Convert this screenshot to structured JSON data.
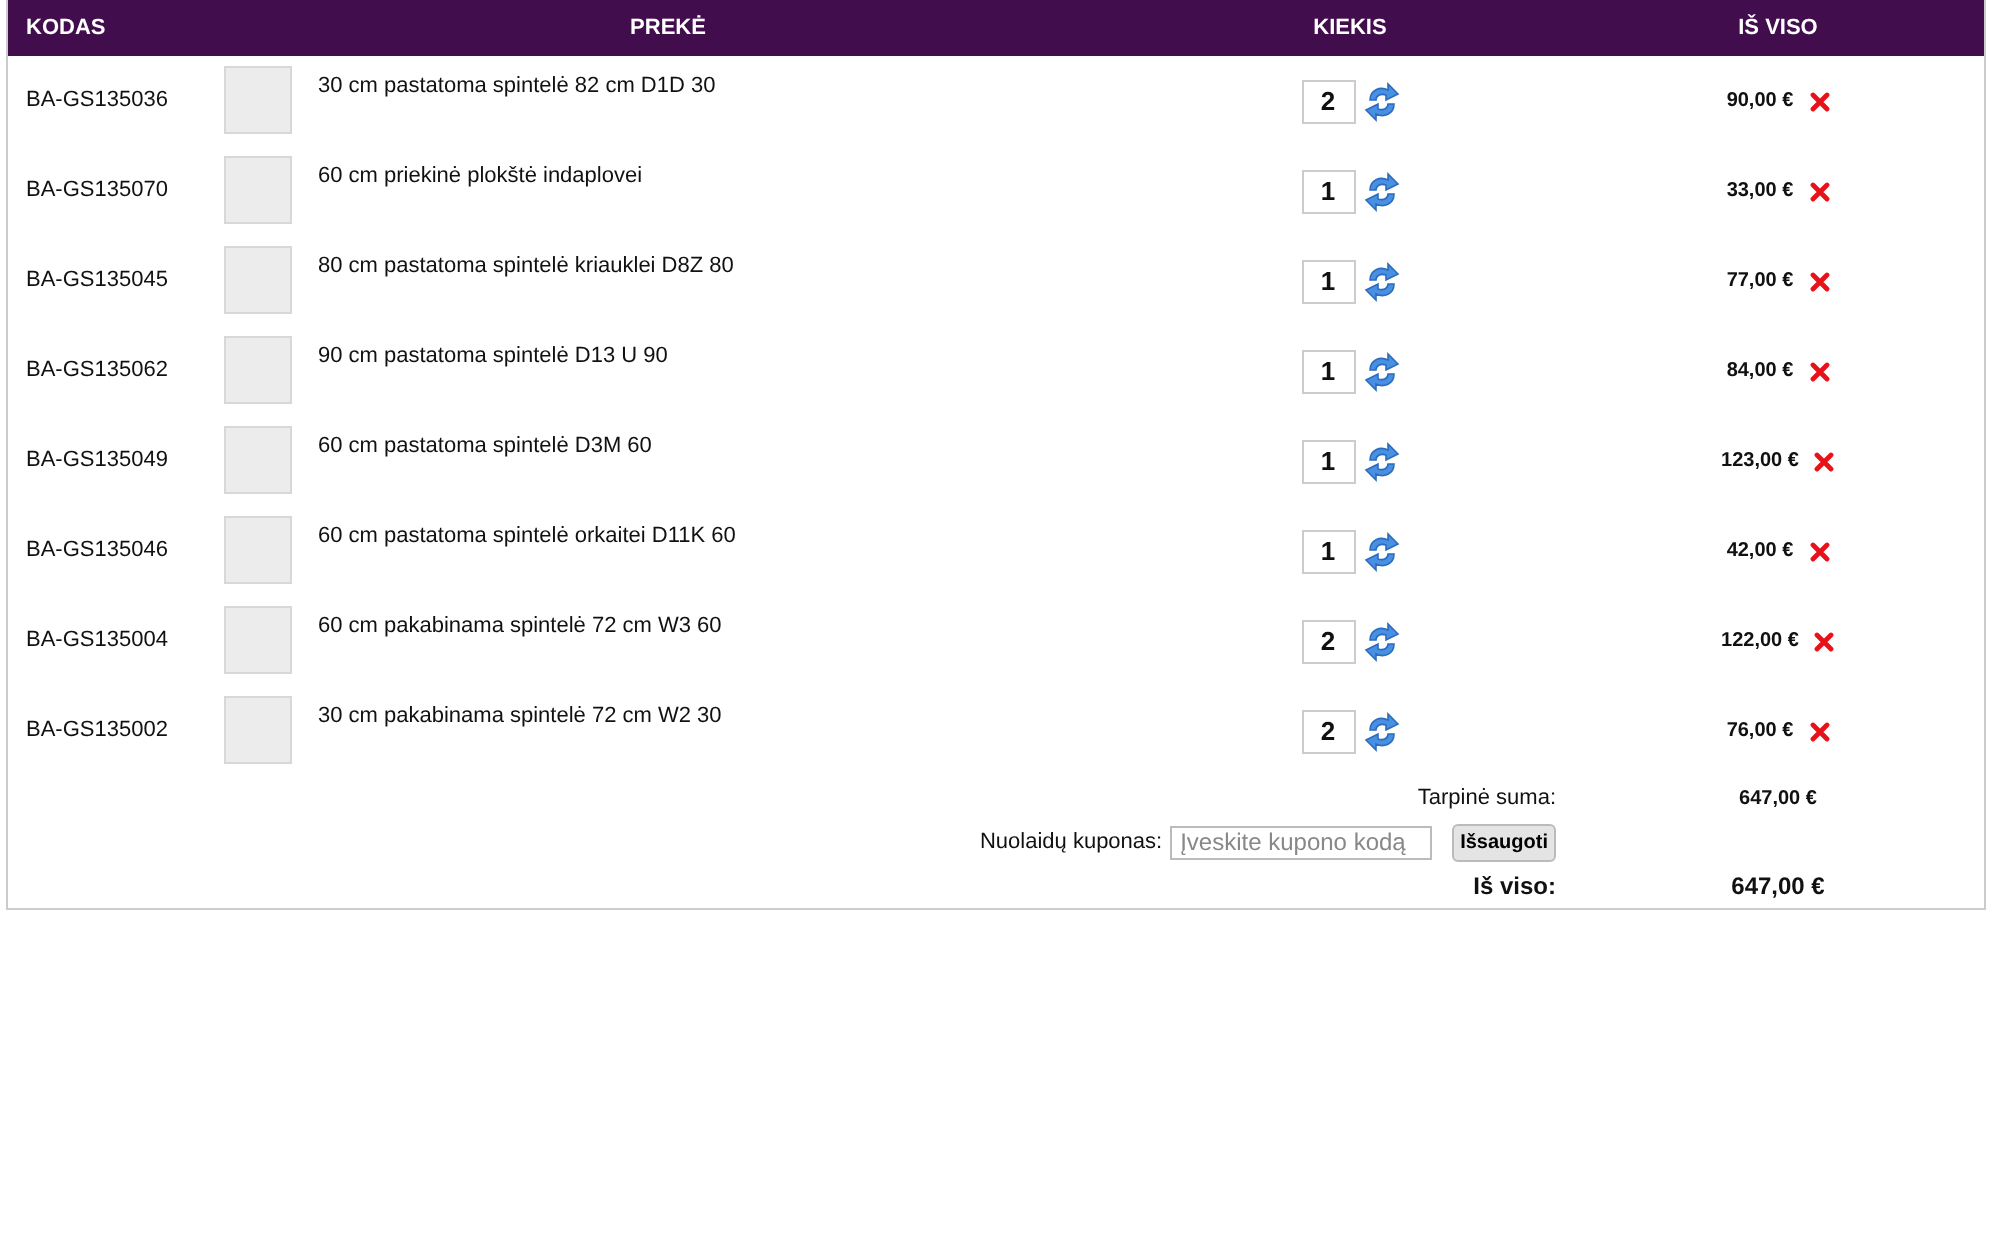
{
  "table": {
    "columns": [
      "KODAS",
      "PREKĖ",
      "KIEKIS",
      "IŠ VISO"
    ],
    "rows": [
      {
        "code": "BA-GS135036",
        "name": "30 cm pastatoma spintelė 82 cm D1D 30",
        "quantity": "2",
        "total": "90,00 €"
      },
      {
        "code": "BA-GS135070",
        "name": "60 cm priekinė plokštė indaplovei",
        "quantity": "1",
        "total": "33,00 €"
      },
      {
        "code": "BA-GS135045",
        "name": "80 cm pastatoma spintelė kriauklei D8Z 80",
        "quantity": "1",
        "total": "77,00 €"
      },
      {
        "code": "BA-GS135062",
        "name": "90 cm pastatoma spintelė D13 U 90",
        "quantity": "1",
        "total": "84,00 €"
      },
      {
        "code": "BA-GS135049",
        "name": "60 cm pastatoma spintelė D3M 60",
        "quantity": "1",
        "total": "123,00 €"
      },
      {
        "code": "BA-GS135046",
        "name": "60 cm pastatoma spintelė orkaitei D11K 60",
        "quantity": "1",
        "total": "42,00 €"
      },
      {
        "code": "BA-GS135004",
        "name": "60 cm pakabinama spintelė 72 cm W3 60",
        "quantity": "2",
        "total": "122,00 €"
      },
      {
        "code": "BA-GS135002",
        "name": "30 cm pakabinama spintelė 72 cm W2 30",
        "quantity": "2",
        "total": "76,00 €"
      }
    ]
  },
  "subtotal": {
    "label": "Tarpinė suma:",
    "value": "647,00 €"
  },
  "coupon": {
    "label": "Nuolaidų kuponas:",
    "placeholder": "Įveskite kupono kodą",
    "button": "Išsaugoti"
  },
  "grand_total": {
    "label": "Iš viso:",
    "value": "647,00 €"
  }
}
